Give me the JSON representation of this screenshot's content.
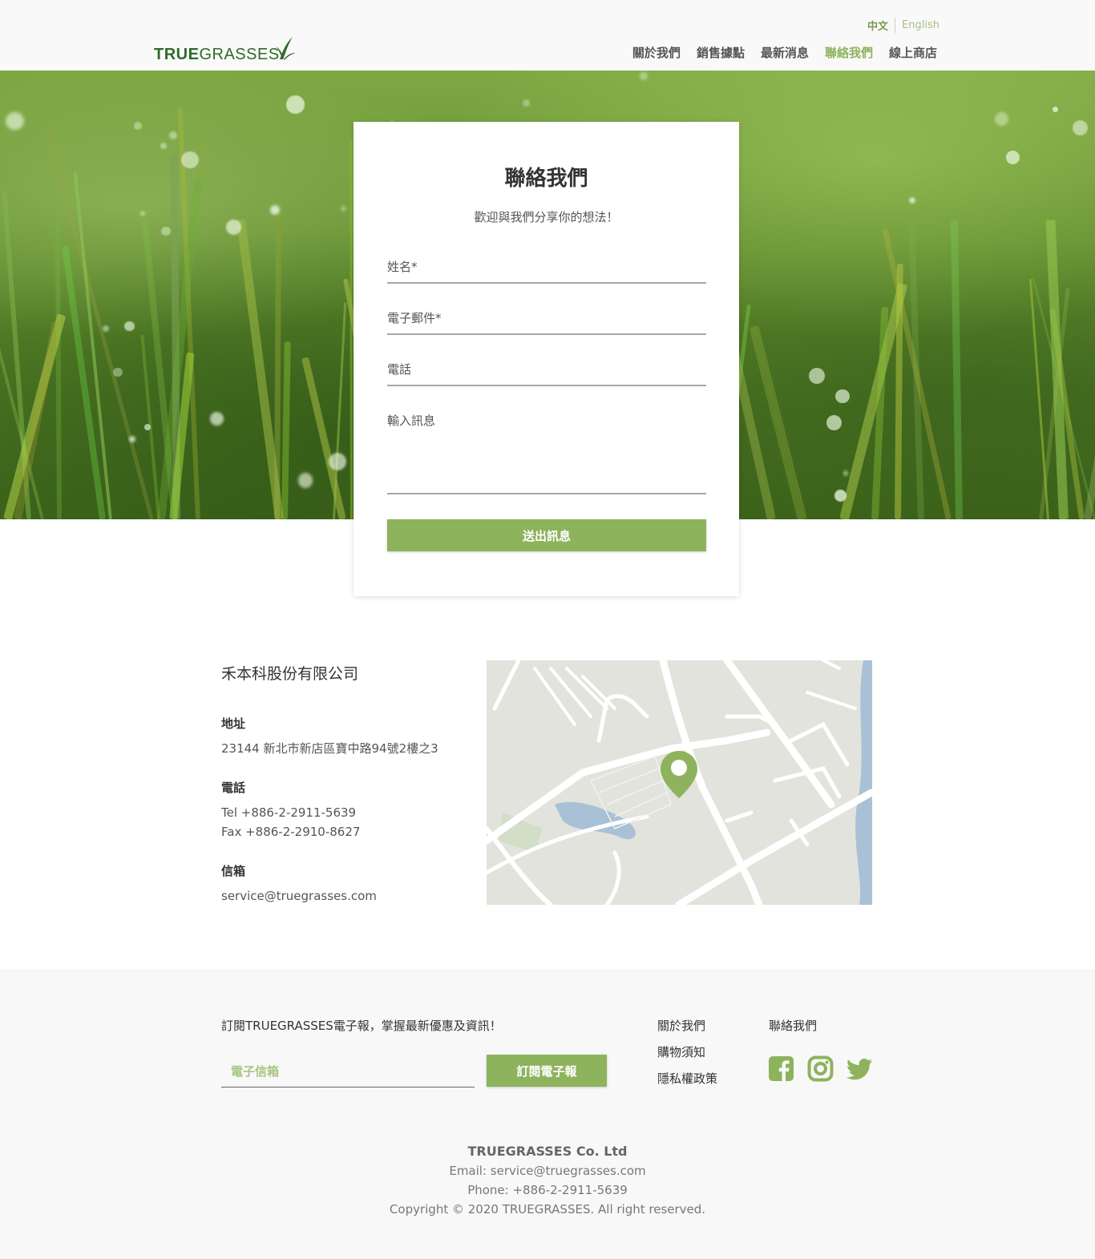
{
  "header": {
    "brand_true": "TRUE",
    "brand_grasses": "GRASSES",
    "lang_zh": "中文",
    "lang_en": "English",
    "nav": [
      "關於我們",
      "銷售據點",
      "最新消息",
      "聯絡我們",
      "線上商店"
    ],
    "active_nav": "聯絡我們"
  },
  "contact_form": {
    "title": "聯絡我們",
    "subtitle": "歡迎與我們分享你的想法！",
    "name_label": "姓名*",
    "email_label": "電子郵件*",
    "phone_label": "電話",
    "message_label": "輸入訊息",
    "submit_label": "送出訊息"
  },
  "company_info": {
    "name": "禾本科股份有限公司",
    "address_label": "地址",
    "address": "23144 新北市新店區寶中路94號2樓之3",
    "phone_label": "電話",
    "tel": "Tel +886-2-2911-5639",
    "fax": "Fax +886-2-2910-8627",
    "email_label": "信箱",
    "email": "service@truegrasses.com"
  },
  "footer": {
    "newsletter_text": "訂閱TRUEGRASSES電子報，掌握最新優惠及資訊！",
    "email_placeholder": "電子信箱",
    "subscribe_label": "訂閱電子報",
    "links": [
      "關於我們",
      "購物須知",
      "隱私權政策"
    ],
    "contact_label": "聯絡我們",
    "social": [
      "facebook-icon",
      "instagram-icon",
      "twitter-icon"
    ],
    "company": "TRUEGRASSES Co. Ltd",
    "email_line": "Email: service@truegrasses.com",
    "phone_line": "Phone: +886-2-2911-5639",
    "copyright": "Copyright © 2020 TRUEGRASSES. All right reserved."
  },
  "colors": {
    "accent": "#8db35d",
    "brand": "#2f6b2b"
  }
}
